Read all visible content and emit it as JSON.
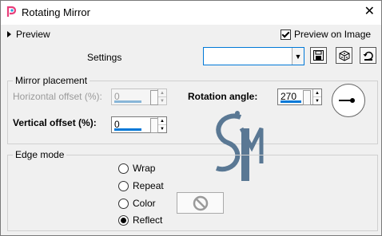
{
  "window": {
    "title": "Rotating Mirror"
  },
  "header": {
    "preview_label": "Preview",
    "preview_on_image_label": "Preview on Image",
    "preview_on_image_checked": true
  },
  "settings": {
    "label": "Settings",
    "preset_value": ""
  },
  "mirror_placement": {
    "title": "Mirror placement",
    "horizontal_offset_label": "Horizontal offset (%):",
    "horizontal_offset_value": "0",
    "vertical_offset_label": "Vertical offset (%):",
    "vertical_offset_value": "0",
    "rotation_angle_label": "Rotation angle:",
    "rotation_angle_value": "270"
  },
  "edge_mode": {
    "title": "Edge mode",
    "options": [
      "Wrap",
      "Repeat",
      "Color",
      "Reflect"
    ],
    "selected": "Reflect"
  },
  "colors": {
    "accent": "#0078d7",
    "watermark": "#5a7894"
  }
}
